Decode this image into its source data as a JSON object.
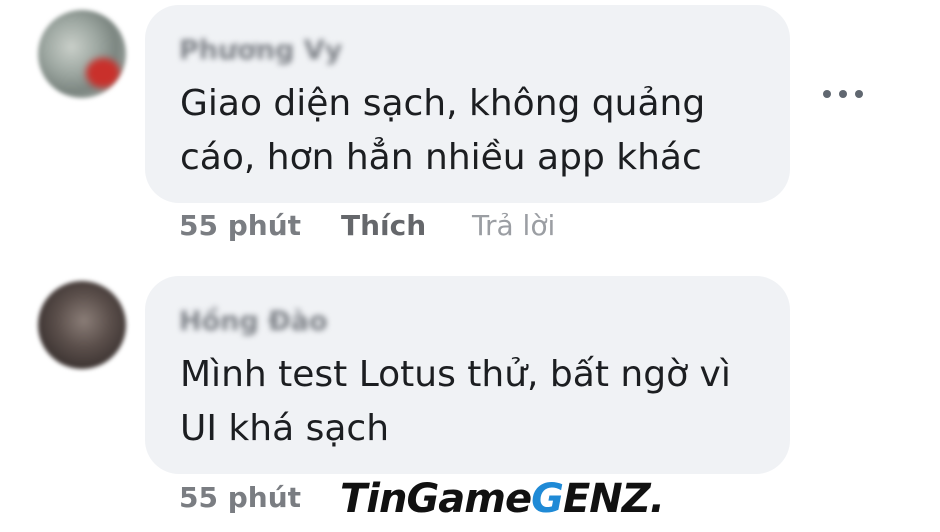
{
  "comments": [
    {
      "author": "Phương Vy",
      "text": "Giao diện sạch, không quảng cáo, hơn hẳn nhiều app khác",
      "time": "55 phút",
      "like_label": "Thích",
      "reply_label": "Trả lời"
    },
    {
      "author": "Hồng Đào",
      "text": "Mình test Lotus thử, bất ngờ vì UI khá sạch",
      "time": "55 phút"
    }
  ],
  "more_options_icon": "more-horizontal-icon",
  "watermark": {
    "part1": "TinGame",
    "part2": "G",
    "part3": "ENZ."
  },
  "colors": {
    "bubble": "#f0f2f5",
    "text": "#1c1e21",
    "meta": "#65676b"
  }
}
